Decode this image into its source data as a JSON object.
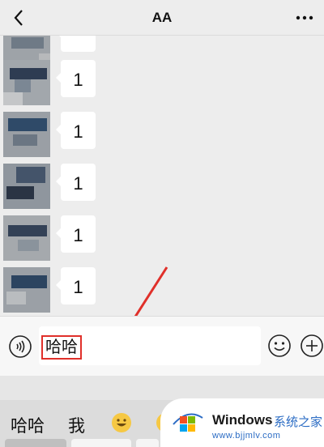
{
  "header": {
    "back_icon": "chevron-left-icon",
    "title": "AA",
    "more_icon": "more-dots-icon"
  },
  "messages": [
    {
      "text": "1"
    },
    {
      "text": "1"
    },
    {
      "text": "1"
    },
    {
      "text": "1"
    },
    {
      "text": "1"
    }
  ],
  "input_bar": {
    "voice_icon": "voice-icon",
    "value": "哈哈",
    "emoji_icon": "emoji-icon",
    "plus_icon": "plus-icon"
  },
  "suggestions": {
    "items": [
      "哈哈",
      "我"
    ],
    "emoji_icon": "grinning-emoji-icon"
  },
  "watermark": {
    "brand": "Windows",
    "brand_cn": "系统之家",
    "url": "www.bjjmlv.com"
  },
  "colors": {
    "background": "#ededed",
    "bubble": "#ffffff",
    "highlight_box": "#e0302a",
    "arrow": "#e0302a",
    "watermark_blue": "#2b6cc4"
  }
}
